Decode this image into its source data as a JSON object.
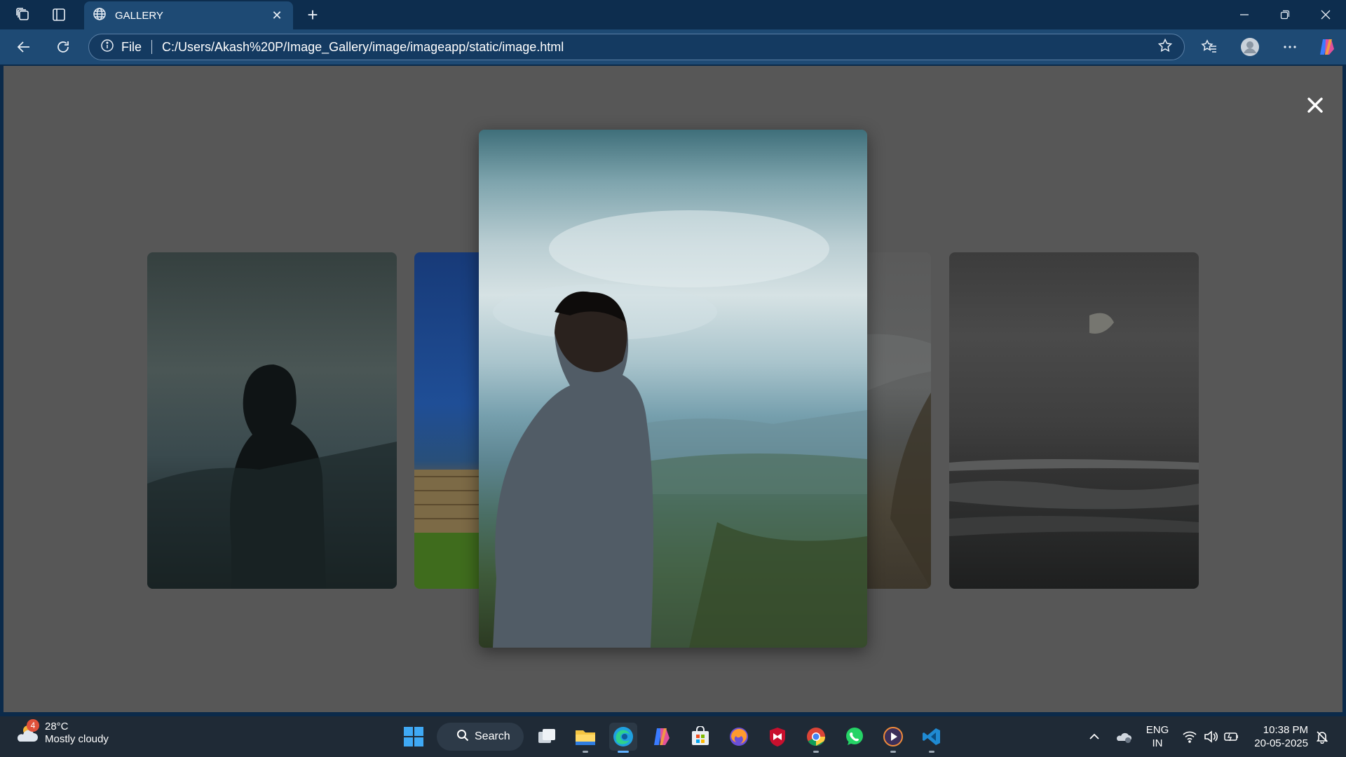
{
  "browser": {
    "tab": {
      "title": "GALLERY"
    },
    "address": {
      "scheme_label": "File",
      "url": "C:/Users/Akash%20P/Image_Gallery/image/imageapp/static/image.html"
    }
  },
  "gallery": {
    "close_symbol": "✕",
    "images": [
      {
        "description": "person in hoodie facing misty hills, dark tone",
        "state": "side"
      },
      {
        "description": "blue sky over building and green lawn",
        "state": "side"
      },
      {
        "description": "person in grey hoodie looking over cloudy valley",
        "state": "focused"
      },
      {
        "description": "beach and waves, muted",
        "state": "side"
      },
      {
        "description": "dark sea with clouds",
        "state": "side"
      }
    ]
  },
  "taskbar": {
    "weather": {
      "badge": "4",
      "temperature": "28°C",
      "condition": "Mostly cloudy"
    },
    "search_label": "Search",
    "language": {
      "line1": "ENG",
      "line2": "IN"
    },
    "clock": {
      "time": "10:38 PM",
      "date": "20-05-2025"
    }
  },
  "colors": {
    "title_bar": "#0d2d4e",
    "nav_bar": "#1e4a74",
    "page_background": "#575757",
    "taskbar": "#1f2a36"
  }
}
